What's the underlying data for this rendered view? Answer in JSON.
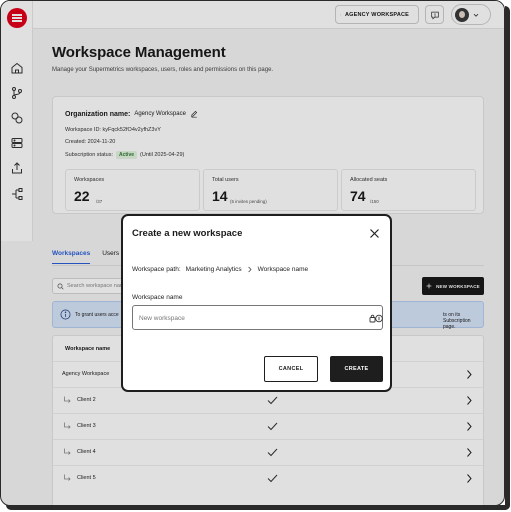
{
  "topbar": {
    "workspace_label": "AGENCY WORKSPACE"
  },
  "page": {
    "title": "Workspace Management",
    "subtitle": "Manage your Supermetrics workspaces, users, roles and permissions on this page."
  },
  "organization": {
    "name_label": "Organization name:",
    "name_value": "Agency Workspace",
    "workspace_id": "Workspace ID:  kyFqck52fO4v2yfhZ3vY",
    "created": "Created:  2024-11-20",
    "subscription_label": "Subscription status:",
    "subscription_badge": "Active",
    "subscription_until": "(Until 2025-04-29)",
    "stats": [
      {
        "label": "Workspaces",
        "value": "22",
        "extra": "/37"
      },
      {
        "label": "Total users",
        "value": "14",
        "extra": "(5 invites pending)"
      },
      {
        "label": "Allocated seats",
        "value": "74",
        "extra": "/150"
      }
    ]
  },
  "tabs": [
    {
      "label": "Workspaces",
      "active": true
    },
    {
      "label": "Users",
      "active": false
    }
  ],
  "toolbar": {
    "search_placeholder": "Search workspace name",
    "new_button": "NEW WORKSPACE"
  },
  "info_banner": {
    "text_left": "To grant users acce",
    "text_right": "ts on its Subscription page."
  },
  "table": {
    "header": "Workspace name",
    "rows": [
      {
        "name": "Agency Workspace",
        "child": false,
        "check": false
      },
      {
        "name": "Client 2",
        "child": true,
        "check": true
      },
      {
        "name": "Client 3",
        "child": true,
        "check": true
      },
      {
        "name": "Client 4",
        "child": true,
        "check": true
      },
      {
        "name": "Client 5",
        "child": true,
        "check": true
      }
    ]
  },
  "modal": {
    "title": "Create a new workspace",
    "path_label": "Workspace path:",
    "path_parent": "Marketing Analytics",
    "path_current": "Workspace name",
    "field_label": "Workspace name",
    "field_placeholder": "New workspace",
    "field_value": "",
    "cancel_label": "CANCEL",
    "create_label": "CREATE"
  },
  "colors": {
    "brand_red": "#e3001b",
    "active_tab": "#2b5fd9",
    "info_bg": "#d8e6fb",
    "primary_button": "#1e1e1e",
    "active_badge": "#e4f4e1"
  }
}
